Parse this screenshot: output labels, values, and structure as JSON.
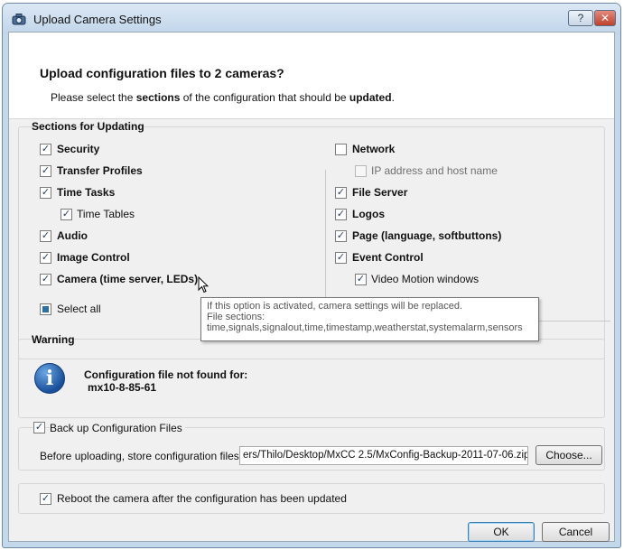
{
  "window": {
    "title": "Upload Camera Settings",
    "help_label": "?",
    "close_label": "✕"
  },
  "header": {
    "title": "Upload configuration files to 2 cameras?",
    "sub_pre": "Please select the ",
    "sub_b1": "sections",
    "sub_mid": " of the configuration that should be ",
    "sub_b2": "updated",
    "sub_end": "."
  },
  "sections": {
    "label": "Sections for Updating",
    "left": [
      {
        "label": "Security",
        "checked": true
      },
      {
        "label": "Transfer Profiles",
        "checked": true
      },
      {
        "label": "Time Tasks",
        "checked": true
      },
      {
        "label": "Time Tables",
        "checked": true
      },
      {
        "label": "Audio",
        "checked": true
      },
      {
        "label": "Image Control",
        "checked": true
      },
      {
        "label": "Camera (time server, LEDs)",
        "checked": true
      }
    ],
    "right": [
      {
        "label": "Network",
        "checked": false
      },
      {
        "label": "IP address and host name",
        "checked": false,
        "disabled": true
      },
      {
        "label": "File Server",
        "checked": true
      },
      {
        "label": "Logos",
        "checked": true
      },
      {
        "label": "Page (language, softbuttons)",
        "checked": true
      },
      {
        "label": "Event Control",
        "checked": true
      },
      {
        "label": "Video Motion windows",
        "checked": true
      }
    ],
    "select_all": "Select all"
  },
  "tooltip": {
    "line1": "If this option is activated, camera settings will be replaced.",
    "line2": "File sections:",
    "line3": "time,signals,signalout,time,timestamp,weatherstat,systemalarm,sensors"
  },
  "warning": {
    "label": "Warning",
    "message": "Configuration file not found for:",
    "camera": "mx10-8-85-61"
  },
  "backup": {
    "label": "Back up Configuration Files",
    "checked": true,
    "store_label": "Before uploading, store configuration files:",
    "path": "ers/Thilo/Desktop/MxCC 2.5/MxConfig-Backup-2011-07-06.zip",
    "choose_label": "Choose..."
  },
  "reboot": {
    "label": "Reboot the camera after the configuration has been updated",
    "checked": true
  },
  "footer": {
    "ok_label": "OK",
    "cancel_label": "Cancel"
  },
  "colors": {
    "title_bar": "#c4d8ec",
    "close_button": "#c0402c",
    "info_icon": "#1a4f9a"
  }
}
